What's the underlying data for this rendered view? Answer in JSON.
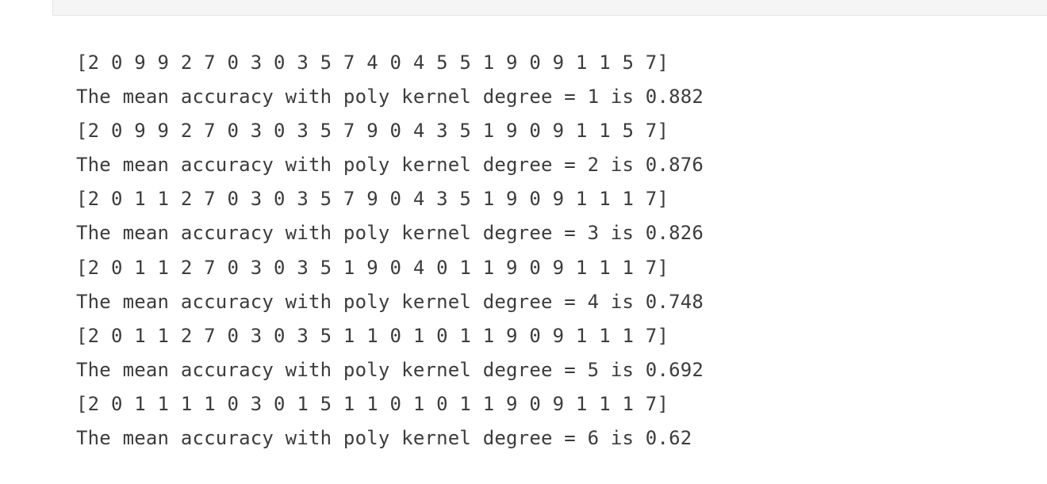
{
  "output": {
    "lines": [
      "[2 0 9 9 2 7 0 3 0 3 5 7 4 0 4 5 5 1 9 0 9 1 1 5 7]",
      "The mean accuracy with poly kernel degree = 1 is 0.882",
      "[2 0 9 9 2 7 0 3 0 3 5 7 9 0 4 3 5 1 9 0 9 1 1 5 7]",
      "The mean accuracy with poly kernel degree = 2 is 0.876",
      "[2 0 1 1 2 7 0 3 0 3 5 7 9 0 4 3 5 1 9 0 9 1 1 1 7]",
      "The mean accuracy with poly kernel degree = 3 is 0.826",
      "[2 0 1 1 2 7 0 3 0 3 5 1 9 0 4 0 1 1 9 0 9 1 1 1 7]",
      "The mean accuracy with poly kernel degree = 4 is 0.748",
      "[2 0 1 1 2 7 0 3 0 3 5 1 1 0 1 0 1 1 9 0 9 1 1 1 7]",
      "The mean accuracy with poly kernel degree = 5 is 0.692",
      "[2 0 1 1 1 1 0 3 0 1 5 1 1 0 1 0 1 1 9 0 9 1 1 1 7]",
      "The mean accuracy with poly kernel degree = 6 is 0.62"
    ]
  }
}
